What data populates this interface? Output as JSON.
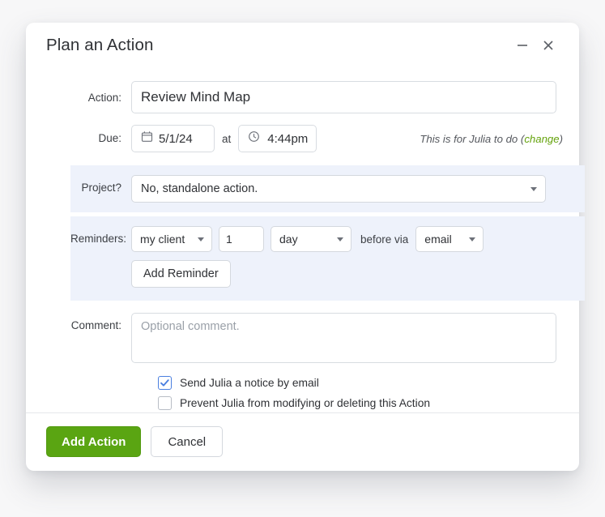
{
  "dialog": {
    "title": "Plan an Action",
    "minimize_icon": "minimize-icon",
    "close_icon": "close-icon"
  },
  "form": {
    "action": {
      "label": "Action:",
      "value": "Review Mind Map",
      "placeholder": ""
    },
    "due": {
      "label": "Due:",
      "date_value": "5/1/24",
      "date_icon": "calendar-icon",
      "at_label": "at",
      "time_value": "4:44pm",
      "time_icon": "clock-icon",
      "assignee_note_prefix": "This is for Julia to do (",
      "assignee_note_link": "change",
      "assignee_note_suffix": ")"
    },
    "project": {
      "label": "Project?",
      "selected": "No, standalone action.",
      "caret_icon": "chevron-down-icon"
    },
    "reminders": {
      "label": "Reminders:",
      "who_selected": "my client",
      "amount_value": "1",
      "unit_selected": "day",
      "middle_label": "before via",
      "via_selected": "email",
      "add_button": "Add Reminder"
    },
    "comment": {
      "label": "Comment:",
      "value": "",
      "placeholder": "Optional comment."
    },
    "checkboxes": [
      {
        "label": "Send Julia a notice by email",
        "checked": true
      },
      {
        "label": "Prevent Julia from modifying or deleting this Action",
        "checked": false
      }
    ]
  },
  "footer": {
    "submit_label": "Add Action",
    "cancel_label": "Cancel"
  },
  "colors": {
    "primary_button": "#5aa512",
    "link_green": "#65a30d",
    "panel_background": "#eef2fb",
    "checkbox_checked": "#4a7fe0"
  }
}
